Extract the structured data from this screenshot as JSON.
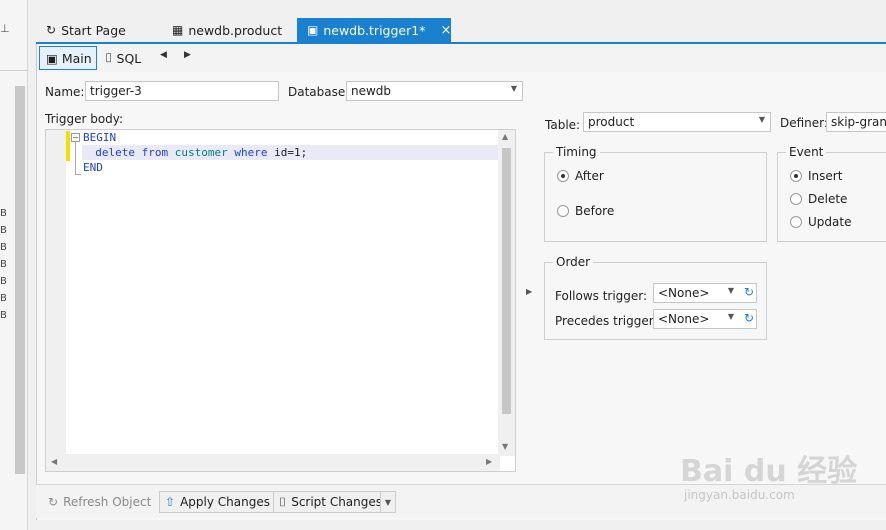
{
  "tabs": [
    {
      "label": "Start Page",
      "icon": "start-page-icon"
    },
    {
      "label": "newdb.product",
      "icon": "table-icon"
    },
    {
      "label": "newdb.trigger1*",
      "icon": "trigger-icon",
      "close": "×"
    }
  ],
  "subtabs": {
    "main": "Main",
    "sql": "SQL"
  },
  "form": {
    "name_label": "Name:",
    "name_value": "trigger-3",
    "database_label": "Database:",
    "database_value": "newdb",
    "body_label": "Trigger body:",
    "table_label": "Table:",
    "table_value": "product",
    "definer_label": "Definer:",
    "definer_value": "skip-grants"
  },
  "code_lines": [
    {
      "kw": "BEGIN"
    },
    {
      "kw1": "delete",
      "kw2": "from",
      "ident": "customer",
      "kw3": "where",
      "cond": "id=1;"
    },
    {
      "kw": "END"
    }
  ],
  "timing": {
    "title": "Timing",
    "after": "After",
    "before": "Before"
  },
  "event": {
    "title": "Event",
    "insert": "Insert",
    "delete": "Delete",
    "update": "Update"
  },
  "order": {
    "title": "Order",
    "follows_label": "Follows trigger:",
    "follows_value": "<None>",
    "precedes_label": "Precedes trigger:",
    "precedes_value": "<None>"
  },
  "bottom": {
    "refresh": "Refresh Object",
    "apply": "Apply Changes",
    "script": "Script Changes"
  },
  "left_strip_labels": [
    "B",
    "B",
    "B",
    "B",
    "B",
    "B",
    "B"
  ],
  "watermark": {
    "main": "Bai du 经验",
    "sub": "jingyan.baidu.com"
  },
  "colors": {
    "accent": "#1a80d0",
    "change_bar": "#f0e000"
  }
}
